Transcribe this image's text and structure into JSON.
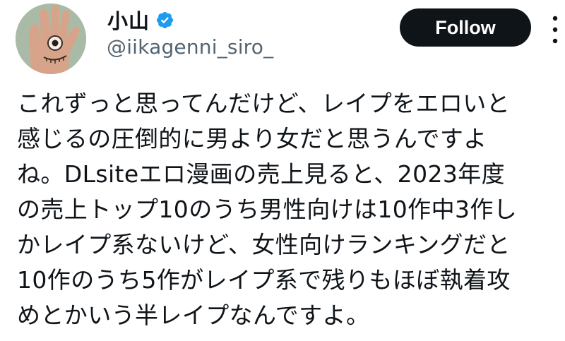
{
  "author": {
    "display_name": "小山",
    "handle": "@iikagenni_siro_",
    "avatar_icon": "hand-with-eye-avatar",
    "verified_icon": "verified-badge-icon",
    "verified_color": "#1d9bf0"
  },
  "actions": {
    "follow_label": "Follow",
    "more_icon": "more-options-icon"
  },
  "tweet": {
    "lines": [
      "これずっと思ってんだけど、レイプをエロいと",
      "感じるの圧倒的に男より女だと思うんですよ",
      "ね。DLsiteエロ漫画の売上見ると、2023年度",
      "の売上トップ10のうち男性向けは10作中3作し",
      "かレイプ系ないけど、女性向けランキングだと",
      "10作のうち5作がレイプ系で残りもほぼ執着攻",
      "めとかいう半レイプなんですよ。"
    ]
  },
  "colors": {
    "text": "#0f1419",
    "secondary_text": "#536471",
    "follow_bg": "#0f1419",
    "follow_text": "#ffffff"
  }
}
